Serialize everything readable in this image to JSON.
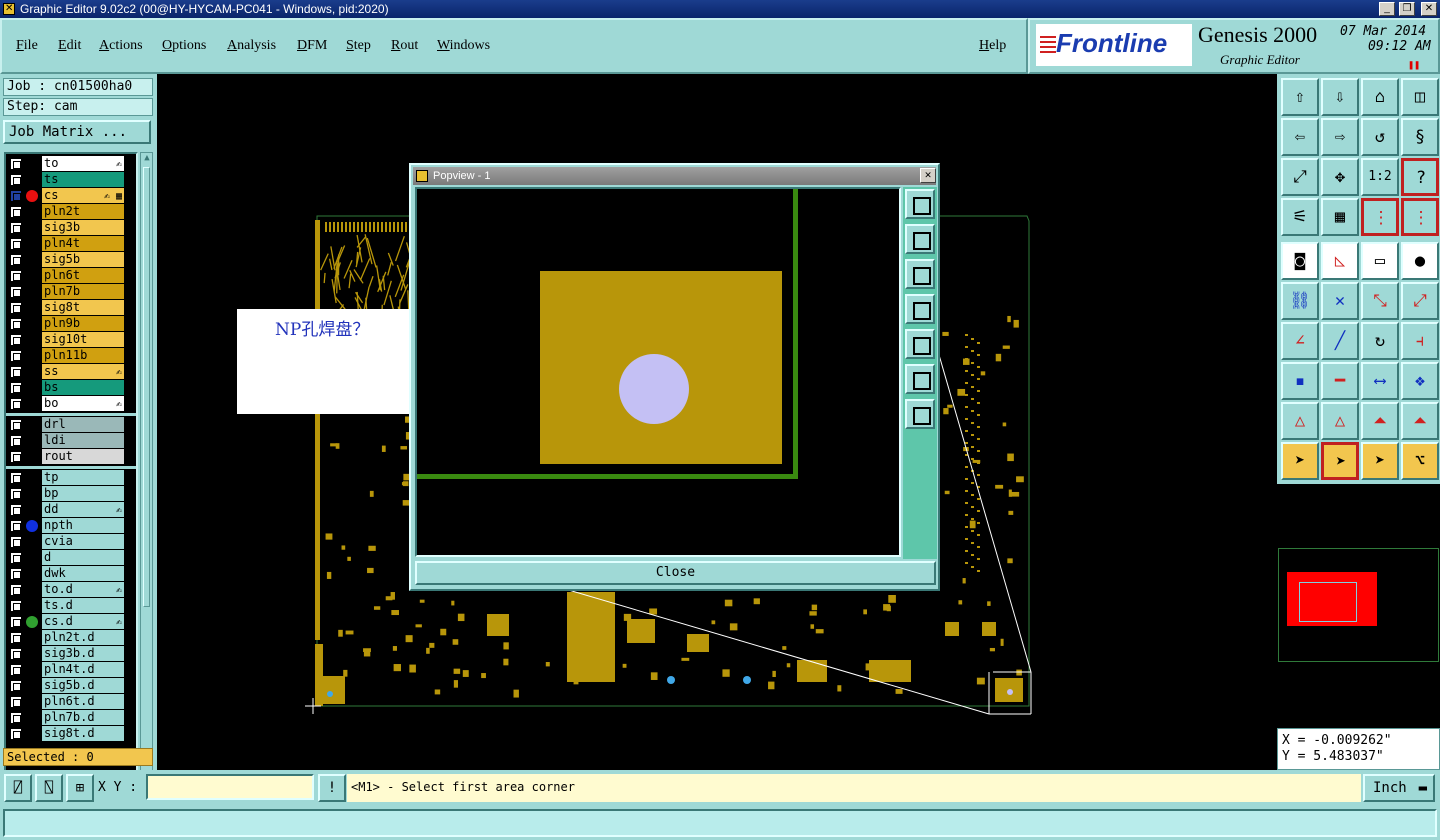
{
  "window": {
    "title": "Graphic Editor 9.02c2 (00@HY-HYCAM-PC041 - Windows, pid:2020)"
  },
  "menu": [
    "File",
    "Edit",
    "Actions",
    "Options",
    "Analysis",
    "DFM",
    "Step",
    "Rout",
    "Windows"
  ],
  "help_label": "Help",
  "brand": {
    "logo": "Frontline",
    "product": "Genesis 2000",
    "subtitle": "Graphic Editor",
    "date": "07 Mar 2014",
    "time": "09:12 AM"
  },
  "job": {
    "job_label": "Job : cn01500ha0",
    "step_label": "Step: cam",
    "matrix_button": "Job Matrix ..."
  },
  "layers_board": [
    {
      "name": "to",
      "color": "#ffffff",
      "mark": "✍"
    },
    {
      "name": "ts",
      "color": "#159a7c",
      "mark": ""
    },
    {
      "name": "cs",
      "color": "#f2c64e",
      "mark": "✍ ▦",
      "selected": true,
      "dot": "#e81010"
    },
    {
      "name": "pln2t",
      "color": "#d0a010",
      "mark": ""
    },
    {
      "name": "sig3b",
      "color": "#f2c64e",
      "mark": ""
    },
    {
      "name": "pln4t",
      "color": "#d0a010",
      "mark": ""
    },
    {
      "name": "sig5b",
      "color": "#f2c64e",
      "mark": ""
    },
    {
      "name": "pln6t",
      "color": "#d0a010",
      "mark": ""
    },
    {
      "name": "pln7b",
      "color": "#d0a010",
      "mark": ""
    },
    {
      "name": "sig8t",
      "color": "#f2c64e",
      "mark": ""
    },
    {
      "name": "pln9b",
      "color": "#d0a010",
      "mark": ""
    },
    {
      "name": "sig10t",
      "color": "#f2c64e",
      "mark": ""
    },
    {
      "name": "pln11b",
      "color": "#d0a010",
      "mark": ""
    },
    {
      "name": "ss",
      "color": "#f2c64e",
      "mark": "✍"
    },
    {
      "name": "bs",
      "color": "#159a7c",
      "mark": ""
    },
    {
      "name": "bo",
      "color": "#ffffff",
      "mark": "✍"
    }
  ],
  "layers_drill": [
    {
      "name": "drl",
      "color": "#9ab8b8",
      "mark": ""
    },
    {
      "name": "ldi",
      "color": "#9ab8b8",
      "mark": ""
    },
    {
      "name": "rout",
      "color": "#d8d8d8",
      "mark": ""
    }
  ],
  "layers_misc": [
    {
      "name": "tp",
      "color": "#9fd9d6",
      "mark": ""
    },
    {
      "name": "bp",
      "color": "#9fd9d6",
      "mark": ""
    },
    {
      "name": "dd",
      "color": "#9fd9d6",
      "mark": "✍"
    },
    {
      "name": "npth",
      "color": "#9fd9d6",
      "mark": "",
      "dot": "#1030e0"
    },
    {
      "name": "cvia",
      "color": "#9fd9d6",
      "mark": ""
    },
    {
      "name": "d",
      "color": "#9fd9d6",
      "mark": ""
    },
    {
      "name": "dwk",
      "color": "#9fd9d6",
      "mark": ""
    },
    {
      "name": "to.d",
      "color": "#9fd9d6",
      "mark": "✍"
    },
    {
      "name": "ts.d",
      "color": "#9fd9d6",
      "mark": ""
    },
    {
      "name": "cs.d",
      "color": "#9fd9d6",
      "mark": "✍",
      "dot": "#30a030"
    },
    {
      "name": "pln2t.d",
      "color": "#9fd9d6",
      "mark": ""
    },
    {
      "name": "sig3b.d",
      "color": "#9fd9d6",
      "mark": ""
    },
    {
      "name": "pln4t.d",
      "color": "#9fd9d6",
      "mark": ""
    },
    {
      "name": "sig5b.d",
      "color": "#9fd9d6",
      "mark": ""
    },
    {
      "name": "pln6t.d",
      "color": "#9fd9d6",
      "mark": ""
    },
    {
      "name": "pln7b.d",
      "color": "#9fd9d6",
      "mark": ""
    },
    {
      "name": "sig8t.d",
      "color": "#9fd9d6",
      "mark": ""
    }
  ],
  "selected_label": "Selected : 0",
  "note": "NP孔焊盘？",
  "popview": {
    "title": "Popview - 1",
    "close_label": "Close",
    "pad_color": "#b8960a",
    "hole_color": "#c4c0f4",
    "outline_color": "#3a8a10"
  },
  "coords": {
    "x": "X = -0.009262\"",
    "y": "Y = 5.483037\""
  },
  "command": {
    "xy_label": "X Y :",
    "xy_value": "",
    "prompt": "<M1> - Select first area corner",
    "units": "Inch"
  },
  "colors": {
    "panel": "#9fd9d6",
    "copper": "#b8960a",
    "accent_red": "#ff0000"
  }
}
